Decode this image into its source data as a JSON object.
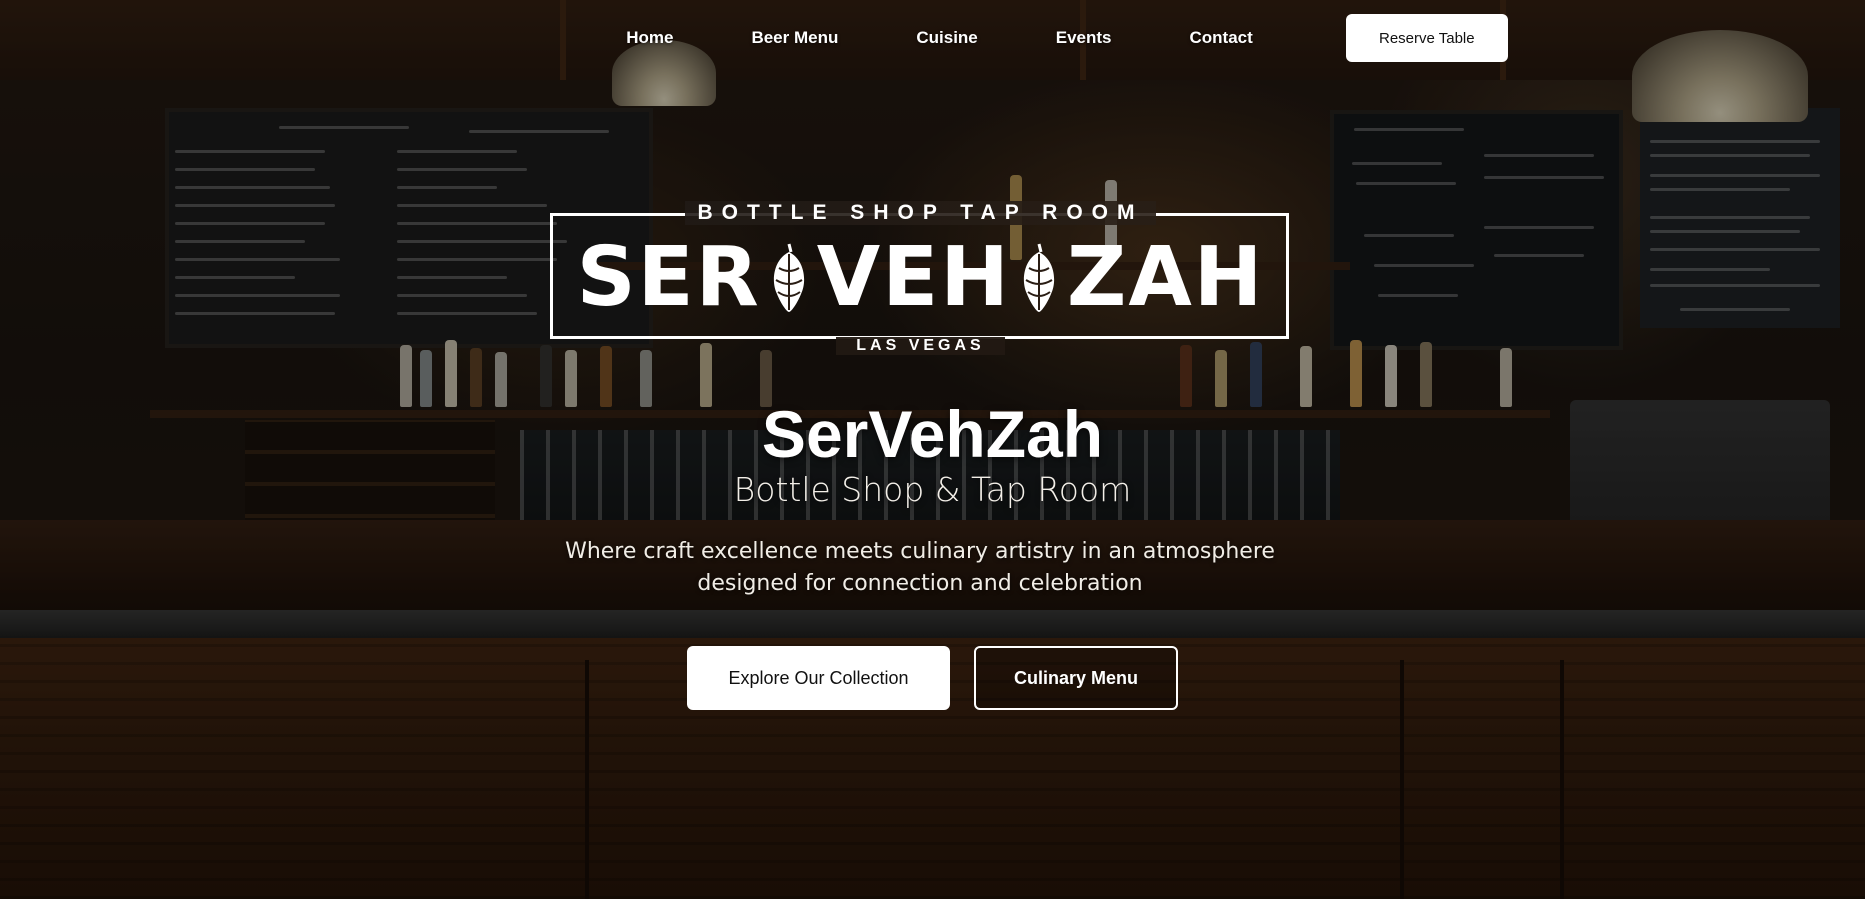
{
  "nav": {
    "links": [
      {
        "label": "Home"
      },
      {
        "label": "Beer Menu"
      },
      {
        "label": "Cuisine"
      },
      {
        "label": "Events"
      },
      {
        "label": "Contact"
      }
    ],
    "cta_label": "Reserve Table"
  },
  "logo": {
    "top_text": "BOTTLE SHOP  TAP ROOM",
    "word_1": "SER",
    "word_2": "VEH",
    "word_3": "ZAH",
    "bottom_text": "LAS VEGAS"
  },
  "hero": {
    "title": "SerVehZah",
    "subtitle": "Bottle Shop & Tap Room",
    "description": "Where craft excellence meets culinary artistry in an atmosphere designed for connection and celebration",
    "primary_button": "Explore Our Collection",
    "secondary_button": "Culinary Menu"
  },
  "colors": {
    "text": "#ffffff",
    "button_bg": "#ffffff",
    "button_text": "#111111",
    "wood": "#3a210f"
  },
  "icons": {
    "logo_ornament": "hop-cone-icon"
  }
}
